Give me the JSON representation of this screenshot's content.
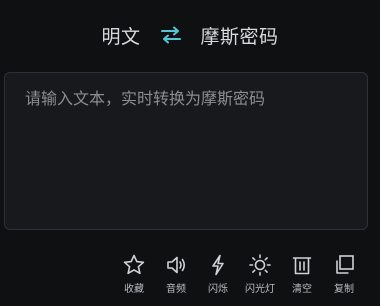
{
  "header": {
    "source_lang": "明文",
    "target_lang": "摩斯密码",
    "swap_icon": "swap-arrows-icon",
    "swap_color": "#54c6d8"
  },
  "editor": {
    "placeholder": "请输入文本，实时转换为摩斯密码",
    "value": ""
  },
  "actions": {
    "favorite": {
      "label": "收藏",
      "icon": "star-icon"
    },
    "audio": {
      "label": "音频",
      "icon": "speaker-icon"
    },
    "flash": {
      "label": "闪烁",
      "icon": "lightning-icon"
    },
    "flashlight": {
      "label": "闪光灯",
      "icon": "sun-icon"
    },
    "clear": {
      "label": "清空",
      "icon": "trash-icon"
    },
    "copy": {
      "label": "复制",
      "icon": "copy-icon"
    }
  },
  "colors": {
    "background": "#0f1012",
    "panel": "#17191c",
    "border": "#2d3035",
    "text": "#d9dadd",
    "placeholder": "#8a8d93",
    "accent": "#54c6d8"
  }
}
